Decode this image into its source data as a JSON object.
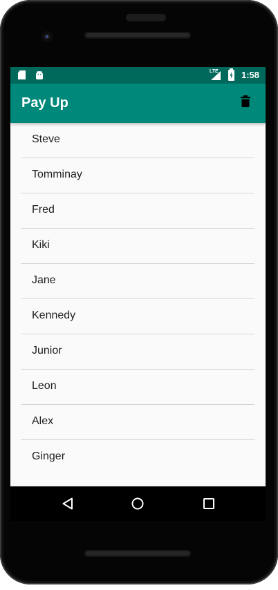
{
  "status_bar": {
    "time": "1:58",
    "network": "LTE",
    "icons": [
      "sd-card-icon",
      "android-debug-icon",
      "signal-icon",
      "battery-charging-icon"
    ]
  },
  "app_bar": {
    "title": "Pay Up",
    "action_icon": "delete-icon",
    "background": "#00897b",
    "status_background": "#00695c"
  },
  "people": [
    {
      "name": "Steve"
    },
    {
      "name": "Tomminay"
    },
    {
      "name": "Fred"
    },
    {
      "name": "Kiki"
    },
    {
      "name": "Jane"
    },
    {
      "name": "Kennedy"
    },
    {
      "name": "Junior"
    },
    {
      "name": "Leon"
    },
    {
      "name": "Alex"
    },
    {
      "name": "Ginger"
    }
  ],
  "nav_bar": {
    "icons": [
      "back-icon",
      "home-icon",
      "recents-icon"
    ]
  }
}
